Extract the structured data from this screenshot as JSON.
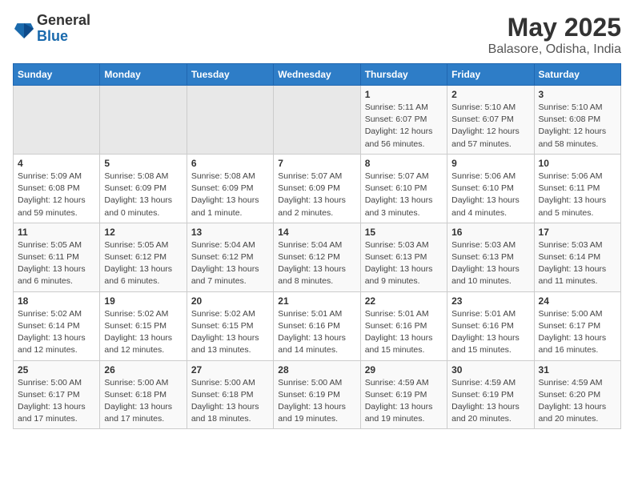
{
  "header": {
    "logo": {
      "line1": "General",
      "line2": "Blue"
    },
    "title": "May 2025",
    "subtitle": "Balasore, Odisha, India"
  },
  "weekdays": [
    "Sunday",
    "Monday",
    "Tuesday",
    "Wednesday",
    "Thursday",
    "Friday",
    "Saturday"
  ],
  "weeks": [
    [
      {
        "day": "",
        "empty": true
      },
      {
        "day": "",
        "empty": true
      },
      {
        "day": "",
        "empty": true
      },
      {
        "day": "",
        "empty": true
      },
      {
        "day": "1",
        "sunrise": "5:11 AM",
        "sunset": "6:07 PM",
        "daylight": "12 hours and 56 minutes."
      },
      {
        "day": "2",
        "sunrise": "5:10 AM",
        "sunset": "6:07 PM",
        "daylight": "12 hours and 57 minutes."
      },
      {
        "day": "3",
        "sunrise": "5:10 AM",
        "sunset": "6:08 PM",
        "daylight": "12 hours and 58 minutes."
      }
    ],
    [
      {
        "day": "4",
        "sunrise": "5:09 AM",
        "sunset": "6:08 PM",
        "daylight": "12 hours and 59 minutes."
      },
      {
        "day": "5",
        "sunrise": "5:08 AM",
        "sunset": "6:09 PM",
        "daylight": "13 hours and 0 minutes."
      },
      {
        "day": "6",
        "sunrise": "5:08 AM",
        "sunset": "6:09 PM",
        "daylight": "13 hours and 1 minute."
      },
      {
        "day": "7",
        "sunrise": "5:07 AM",
        "sunset": "6:09 PM",
        "daylight": "13 hours and 2 minutes."
      },
      {
        "day": "8",
        "sunrise": "5:07 AM",
        "sunset": "6:10 PM",
        "daylight": "13 hours and 3 minutes."
      },
      {
        "day": "9",
        "sunrise": "5:06 AM",
        "sunset": "6:10 PM",
        "daylight": "13 hours and 4 minutes."
      },
      {
        "day": "10",
        "sunrise": "5:06 AM",
        "sunset": "6:11 PM",
        "daylight": "13 hours and 5 minutes."
      }
    ],
    [
      {
        "day": "11",
        "sunrise": "5:05 AM",
        "sunset": "6:11 PM",
        "daylight": "13 hours and 6 minutes."
      },
      {
        "day": "12",
        "sunrise": "5:05 AM",
        "sunset": "6:12 PM",
        "daylight": "13 hours and 6 minutes."
      },
      {
        "day": "13",
        "sunrise": "5:04 AM",
        "sunset": "6:12 PM",
        "daylight": "13 hours and 7 minutes."
      },
      {
        "day": "14",
        "sunrise": "5:04 AM",
        "sunset": "6:12 PM",
        "daylight": "13 hours and 8 minutes."
      },
      {
        "day": "15",
        "sunrise": "5:03 AM",
        "sunset": "6:13 PM",
        "daylight": "13 hours and 9 minutes."
      },
      {
        "day": "16",
        "sunrise": "5:03 AM",
        "sunset": "6:13 PM",
        "daylight": "13 hours and 10 minutes."
      },
      {
        "day": "17",
        "sunrise": "5:03 AM",
        "sunset": "6:14 PM",
        "daylight": "13 hours and 11 minutes."
      }
    ],
    [
      {
        "day": "18",
        "sunrise": "5:02 AM",
        "sunset": "6:14 PM",
        "daylight": "13 hours and 12 minutes."
      },
      {
        "day": "19",
        "sunrise": "5:02 AM",
        "sunset": "6:15 PM",
        "daylight": "13 hours and 12 minutes."
      },
      {
        "day": "20",
        "sunrise": "5:02 AM",
        "sunset": "6:15 PM",
        "daylight": "13 hours and 13 minutes."
      },
      {
        "day": "21",
        "sunrise": "5:01 AM",
        "sunset": "6:16 PM",
        "daylight": "13 hours and 14 minutes."
      },
      {
        "day": "22",
        "sunrise": "5:01 AM",
        "sunset": "6:16 PM",
        "daylight": "13 hours and 15 minutes."
      },
      {
        "day": "23",
        "sunrise": "5:01 AM",
        "sunset": "6:16 PM",
        "daylight": "13 hours and 15 minutes."
      },
      {
        "day": "24",
        "sunrise": "5:00 AM",
        "sunset": "6:17 PM",
        "daylight": "13 hours and 16 minutes."
      }
    ],
    [
      {
        "day": "25",
        "sunrise": "5:00 AM",
        "sunset": "6:17 PM",
        "daylight": "13 hours and 17 minutes."
      },
      {
        "day": "26",
        "sunrise": "5:00 AM",
        "sunset": "6:18 PM",
        "daylight": "13 hours and 17 minutes."
      },
      {
        "day": "27",
        "sunrise": "5:00 AM",
        "sunset": "6:18 PM",
        "daylight": "13 hours and 18 minutes."
      },
      {
        "day": "28",
        "sunrise": "5:00 AM",
        "sunset": "6:19 PM",
        "daylight": "13 hours and 19 minutes."
      },
      {
        "day": "29",
        "sunrise": "4:59 AM",
        "sunset": "6:19 PM",
        "daylight": "13 hours and 19 minutes."
      },
      {
        "day": "30",
        "sunrise": "4:59 AM",
        "sunset": "6:19 PM",
        "daylight": "13 hours and 20 minutes."
      },
      {
        "day": "31",
        "sunrise": "4:59 AM",
        "sunset": "6:20 PM",
        "daylight": "13 hours and 20 minutes."
      }
    ]
  ],
  "labels": {
    "sunrise": "Sunrise:",
    "sunset": "Sunset:",
    "daylight": "Daylight:"
  }
}
